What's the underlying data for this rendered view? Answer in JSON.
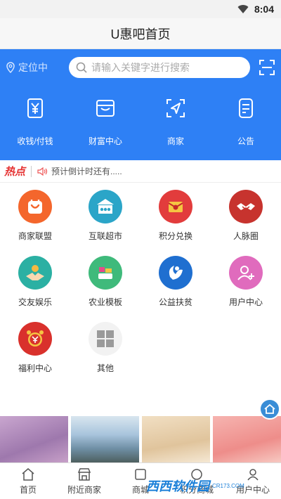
{
  "status_bar": {
    "time": "8:04"
  },
  "header": {
    "title": "U惠吧首页"
  },
  "search": {
    "location": "定位中",
    "placeholder": "请输入关键字进行搜索"
  },
  "quick_actions": [
    {
      "label": "收钱/付钱",
      "icon": "yuan-receipt-icon"
    },
    {
      "label": "财富中心",
      "icon": "wallet-icon"
    },
    {
      "label": "商家",
      "icon": "navigation-icon"
    },
    {
      "label": "公告",
      "icon": "notice-icon"
    }
  ],
  "hot": {
    "logo": "热点",
    "text": "预计倒计时还有....."
  },
  "grid": [
    {
      "label": "商家联盟",
      "icon": "smile-bag-icon",
      "color": "#f4662c"
    },
    {
      "label": "互联超市",
      "icon": "market-icon",
      "color": "#2ba5c8"
    },
    {
      "label": "积分兑换",
      "icon": "red-envelope-icon",
      "color": "#e23c3c"
    },
    {
      "label": "人脉圈",
      "icon": "handshake-icon",
      "color": "#c7332e"
    },
    {
      "label": "交友娱乐",
      "icon": "hands-coin-icon",
      "color": "#2bb0a3"
    },
    {
      "label": "农业模板",
      "icon": "farm-icon",
      "color": "#3fba7b"
    },
    {
      "label": "公益扶贫",
      "icon": "charity-icon",
      "color": "#1f6fd0"
    },
    {
      "label": "用户中心",
      "icon": "user-add-icon",
      "color": "#e06bbd"
    },
    {
      "label": "福利中心",
      "icon": "alarm-clock-icon",
      "color": "#d9312c"
    },
    {
      "label": "其他",
      "icon": "grid-icon",
      "color": "#f2f2f2"
    }
  ],
  "bottom_nav": [
    {
      "label": "首页",
      "icon": "home-icon"
    },
    {
      "label": "附近商家",
      "icon": "shop-icon"
    },
    {
      "label": "商城",
      "icon": "mall-icon"
    },
    {
      "label": "积分商城",
      "icon": "points-mall-icon"
    },
    {
      "label": "用户中心",
      "icon": "user-icon"
    }
  ],
  "watermark": {
    "main": "西西软件园",
    "sub": "CR173.COM"
  },
  "colors": {
    "primary": "#2e80f5",
    "hot": "#e53030"
  }
}
